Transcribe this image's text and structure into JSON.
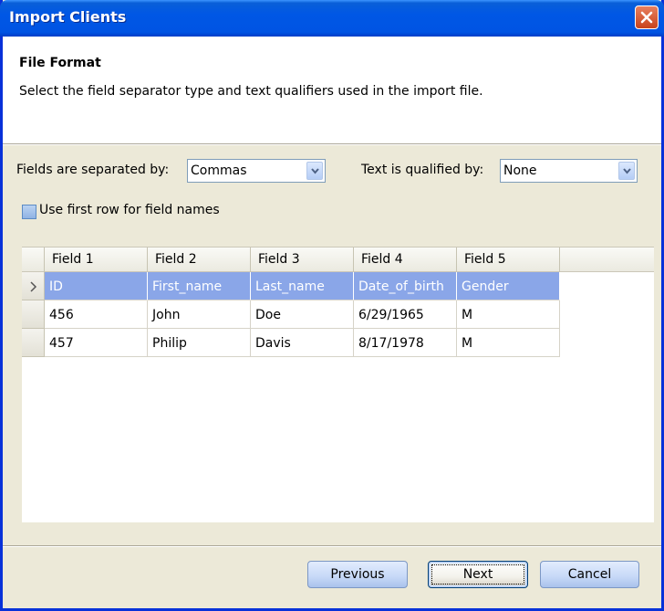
{
  "window": {
    "title": "Import Clients"
  },
  "header": {
    "title": "File Format",
    "subtitle": "Select the field separator type and text qualifiers used in the import  file."
  },
  "options": {
    "separator_label": "Fields are separated by:",
    "separator_value": "Commas",
    "qualifier_label": "Text is qualified by:",
    "qualifier_value": "None",
    "first_row_label": "Use first row for field names",
    "first_row_checked": false
  },
  "grid": {
    "columns": [
      "Field 1",
      "Field 2",
      "Field 3",
      "Field 4",
      "Field 5"
    ],
    "rows": [
      [
        "ID",
        "First_name",
        "Last_name",
        "Date_of_birth",
        "Gender"
      ],
      [
        "456",
        "John",
        "Doe",
        "6/29/1965",
        "M"
      ],
      [
        "457",
        "Philip",
        "Davis",
        "8/17/1978",
        "M"
      ]
    ],
    "selected_row": 0
  },
  "buttons": {
    "previous": "Previous",
    "next": "Next",
    "cancel": "Cancel"
  },
  "colors": {
    "title_bar": "#0054e3",
    "selection": "#8aa6e8",
    "close": "#c8431c"
  },
  "icons": {
    "close": "close-icon",
    "dropdown": "chevron-down-icon",
    "row_pointer": "row-pointer-icon"
  }
}
